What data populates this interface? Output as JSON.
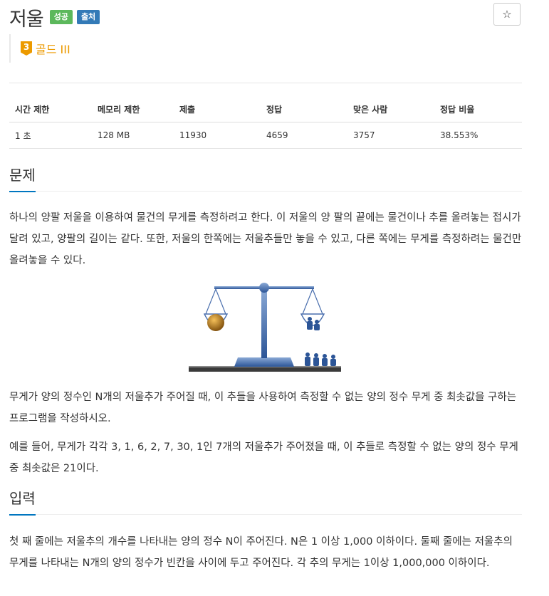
{
  "problem": {
    "title": "저울",
    "badges": [
      {
        "label": "성공",
        "color": "#5cb85c"
      },
      {
        "label": "출처",
        "color": "#337ab7"
      }
    ],
    "star_icon": "☆",
    "tier": {
      "number": "3",
      "label": "골드 III",
      "color": "#ec9a00"
    }
  },
  "info_table": {
    "headers": [
      "시간 제한",
      "메모리 제한",
      "제출",
      "정답",
      "맞은 사람",
      "정답 비율"
    ],
    "row": [
      "1 초",
      "128 MB",
      "11930",
      "4659",
      "3757",
      "38.553%"
    ]
  },
  "sections": {
    "problem": {
      "title": "문제",
      "p1": "하나의 양팔 저울을 이용하여 물건의 무게를 측정하려고 한다. 이 저울의 양 팔의 끝에는 물건이나 추를 올려놓는 접시가 달려 있고, 양팔의 길이는 같다. 또한, 저울의 한쪽에는 저울추들만 놓을 수 있고, 다른 쪽에는 무게를 측정하려는 물건만 올려놓을 수 있다.",
      "p2": "무게가 양의 정수인 N개의 저울추가 주어질 때, 이 추들을 사용하여 측정할 수 없는 양의 정수 무게 중 최솟값을 구하는 프로그램을 작성하시오.",
      "p3": "예를 들어, 무게가 각각 3, 1, 6, 2, 7, 30, 1인 7개의 저울추가 주어졌을 때, 이 추들로 측정할 수 없는 양의 정수 무게 중 최솟값은 21이다."
    },
    "input": {
      "title": "입력",
      "p1": "첫 째 줄에는 저울추의 개수를 나타내는 양의 정수 N이 주어진다. N은 1 이상 1,000 이하이다. 둘째 줄에는 저울추의 무게를 나타내는 N개의 양의 정수가 빈칸을 사이에 두고 주어진다. 각 추의 무게는 1이상 1,000,000 이하이다."
    }
  }
}
